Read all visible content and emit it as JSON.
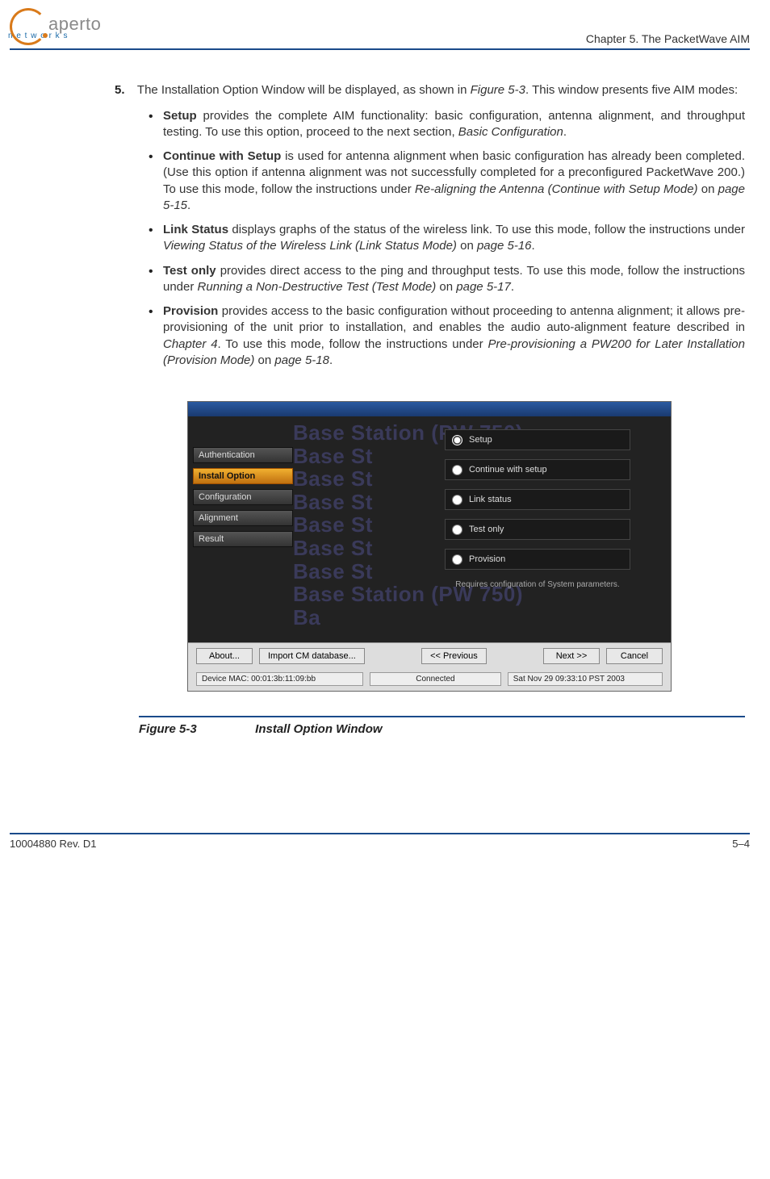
{
  "header": {
    "logo_text": "aperto",
    "logo_sub": "n e t w o r k s",
    "chapter": "Chapter 5.  The PacketWave AIM"
  },
  "step": {
    "number": "5.",
    "intro_1": "The Installation Option Window will be displayed, as shown in ",
    "intro_fig": "Figure 5-3",
    "intro_2": ". This window presents five AIM modes:"
  },
  "modes": {
    "setup": {
      "name": "Setup",
      "body_1": " provides the complete AIM functionality: basic configuration, antenna alignment, and throughput testing. To use this option, proceed to the next section, ",
      "ref": "Basic Configuration",
      "body_2": "."
    },
    "continue": {
      "name": "Continue with Setup",
      "body_1": " is used for antenna alignment when basic configuration has already been completed. (Use this option if antenna alignment was not successfully completed for a preconfigured PacketWave 200.) To use this mode, follow the instructions under ",
      "ref": "Re-aligning the Antenna (Continue with Setup Mode)",
      "on": " on ",
      "page": "page 5-15",
      "body_2": "."
    },
    "link": {
      "name": "Link Status",
      "body_1": " displays graphs of the status of the wireless link. To use this mode, follow the instructions under ",
      "ref": "Viewing Status of the Wireless Link (Link Status Mode)",
      "on": " on ",
      "page": "page 5-16",
      "body_2": "."
    },
    "test": {
      "name": "Test only",
      "body_1": " provides direct access to the ping and throughput tests. To use this mode, follow the instructions under ",
      "ref": "Running a Non-Destructive Test (Test Mode)",
      "on": " on ",
      "page": "page 5-17",
      "body_2": "."
    },
    "provision": {
      "name": "Provision",
      "body_1": " provides access to the basic configuration without proceeding to antenna alignment; it allows pre-provisioning of the unit prior to installation, and enables the audio auto-alignment feature described in ",
      "ref1": "Chapter 4",
      "body_2": ". To use this mode, follow the instructions under ",
      "ref2": "Pre-provisioning a PW200 for Later Installation (Provision Mode)",
      "on": " on ",
      "page": "page 5-18",
      "body_3": "."
    }
  },
  "app": {
    "sidebar": {
      "auth": "Authentication",
      "install": "Install Option",
      "config": "Configuration",
      "align": "Alignment",
      "result": "Result"
    },
    "watermark": "Base Station (PW 750)\nBase St\nBase St\nBase St\nBase St\nBase St\nBase St\nBase Station (PW 750)\nBa",
    "options": {
      "setup": "Setup",
      "continue": "Continue with setup",
      "link": "Link status",
      "test": "Test only",
      "provision": "Provision"
    },
    "hint": "Requires configuration of System parameters.",
    "buttons": {
      "about": "About...",
      "import": "Import CM database...",
      "prev": "<< Previous",
      "next": "Next >>",
      "cancel": "Cancel"
    },
    "status": {
      "mac": "Device MAC: 00:01:3b:11:09:bb",
      "conn": "Connected",
      "time": "Sat Nov 29 09:33:10 PST 2003"
    }
  },
  "figure": {
    "label": "Figure 5-3",
    "title": "Install Option Window"
  },
  "footer": {
    "rev": "10004880 Rev. D1",
    "page": "5–4"
  }
}
